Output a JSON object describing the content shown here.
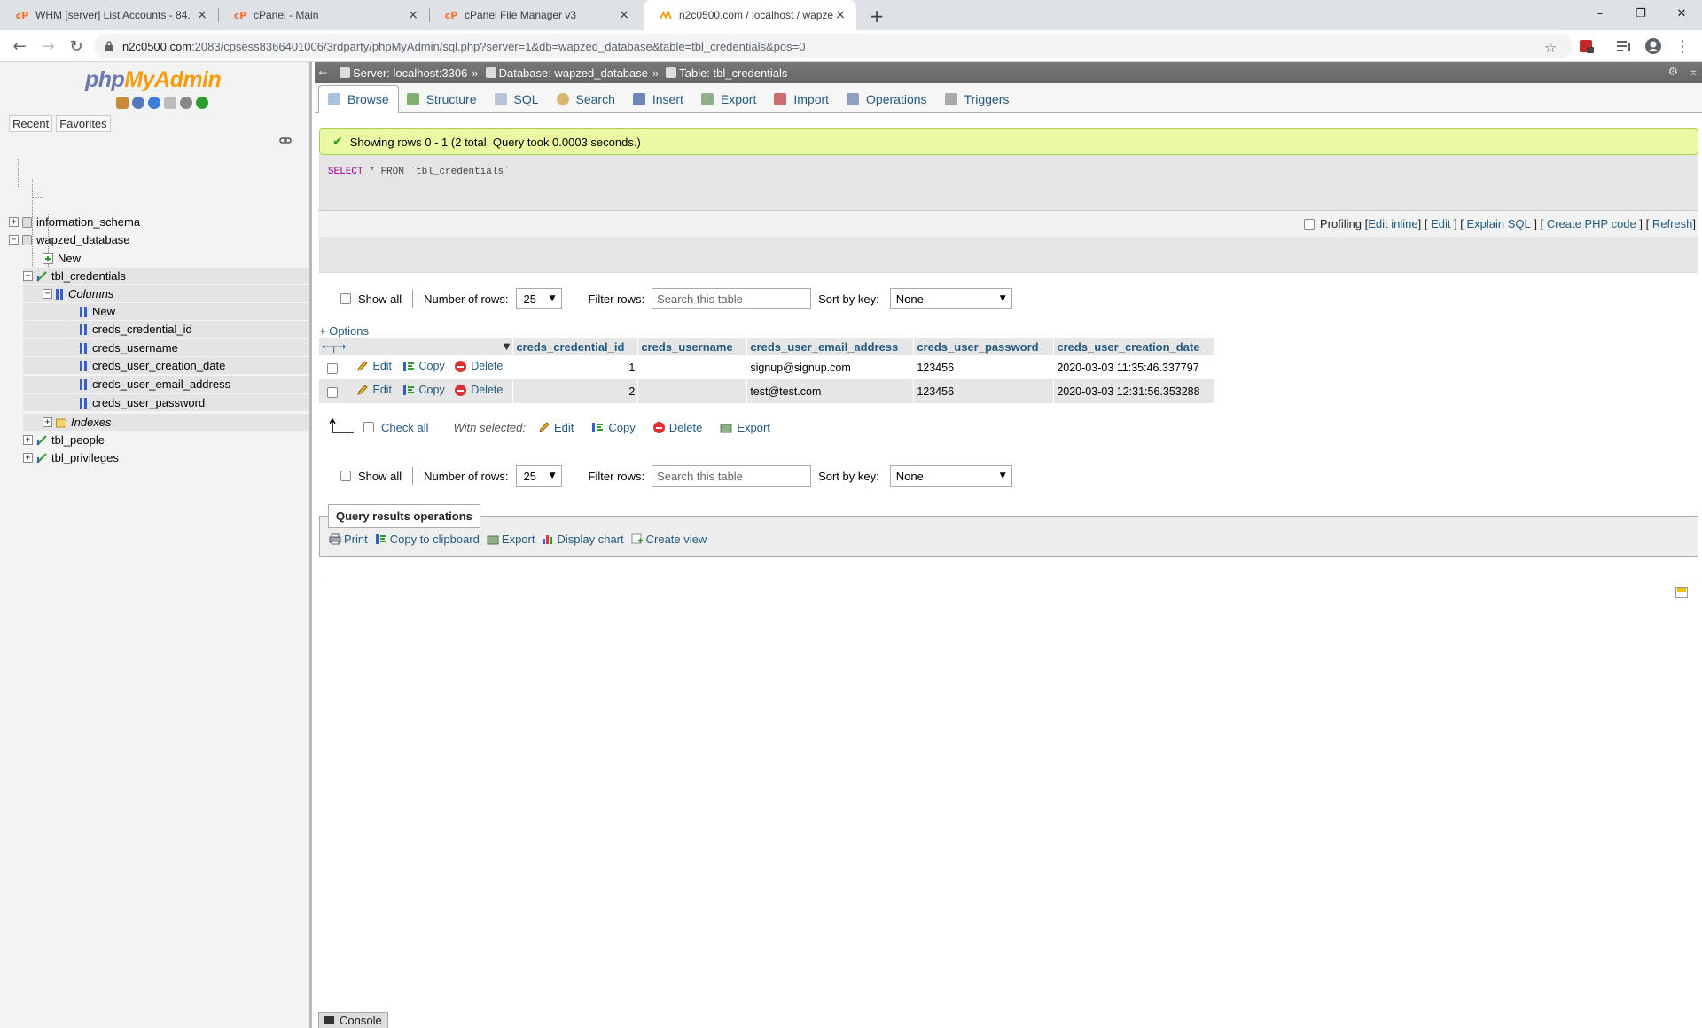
{
  "browser": {
    "tabs": [
      {
        "title": "WHM [server] List Accounts - 84.",
        "favicon": "cpanel-icon"
      },
      {
        "title": "cPanel - Main",
        "favicon": "cpanel-icon"
      },
      {
        "title": "cPanel File Manager v3",
        "favicon": "cpanel-icon"
      },
      {
        "title": "n2c0500.com / localhost / wapze",
        "favicon": "phpmyadmin-icon"
      }
    ],
    "url_host": "n2c0500.com",
    "url_rest": ":2083/cpsess8366401006/3rdparty/phpMyAdmin/sql.php?server=1&db=wapzed_database&table=tbl_credentials&pos=0"
  },
  "sidebar": {
    "logo_php": "php",
    "logo_myadmin": "MyAdmin",
    "nav_tabs": [
      "Recent",
      "Favorites"
    ],
    "tree": {
      "db1": "information_schema",
      "db2": "wapzed_database",
      "db2_new": "New",
      "table1": "tbl_credentials",
      "columns_label": "Columns",
      "columns_new": "New",
      "columns": [
        "creds_credential_id",
        "creds_username",
        "creds_user_creation_date",
        "creds_user_email_address",
        "creds_user_password"
      ],
      "indexes_label": "Indexes",
      "table2": "tbl_people",
      "table3": "tbl_privileges"
    }
  },
  "breadcrumb": {
    "server": "Server: localhost:3306",
    "database": "Database: wapzed_database",
    "table": "Table: tbl_credentials",
    "separator": "»"
  },
  "menu_tabs": [
    "Browse",
    "Structure",
    "SQL",
    "Search",
    "Insert",
    "Export",
    "Import",
    "Operations",
    "Triggers"
  ],
  "result": {
    "message": "Showing rows 0 - 1 (2 total, Query took 0.0003 seconds.)",
    "sql_keyword": "SELECT",
    "sql_star": "*",
    "sql_from": "FROM",
    "sql_table": "`tbl_credentials`"
  },
  "sql_tools": {
    "profiling": "Profiling",
    "edit_inline": "Edit inline",
    "edit": "Edit",
    "explain": "Explain SQL",
    "php_code": "Create PHP code",
    "refresh": "Refresh"
  },
  "nav_controls": {
    "show_all": "Show all",
    "number_of_rows_label": "Number of rows:",
    "number_of_rows_value": "25",
    "filter_label": "Filter rows:",
    "filter_placeholder": "Search this table",
    "sort_label": "Sort by key:",
    "sort_value": "None"
  },
  "options_link": "+ Options",
  "table": {
    "columns": [
      "creds_credential_id",
      "creds_username",
      "creds_user_email_address",
      "creds_user_password",
      "creds_user_creation_date"
    ],
    "rows": [
      {
        "id": "1",
        "username": "",
        "email": "signup@signup.com",
        "password": "123456",
        "created": "2020-03-03 11:35:46.337797"
      },
      {
        "id": "2",
        "username": "",
        "email": "test@test.com",
        "password": "123456",
        "created": "2020-03-03 12:31:56.353288"
      }
    ],
    "row_actions": {
      "edit": "Edit",
      "copy": "Copy",
      "delete": "Delete"
    }
  },
  "with_selected": {
    "check_all": "Check all",
    "label": "With selected:",
    "edit": "Edit",
    "copy": "Copy",
    "delete": "Delete",
    "export": "Export"
  },
  "query_ops": {
    "legend": "Query results operations",
    "print": "Print",
    "copy_clipboard": "Copy to clipboard",
    "export": "Export",
    "display_chart": "Display chart",
    "create_view": "Create view"
  },
  "console": "Console",
  "colors": {
    "link": "#235a81",
    "success_bg": "#ebf8a4",
    "logo_php": "#6c78af",
    "logo_myadmin": "#f89c0e"
  }
}
